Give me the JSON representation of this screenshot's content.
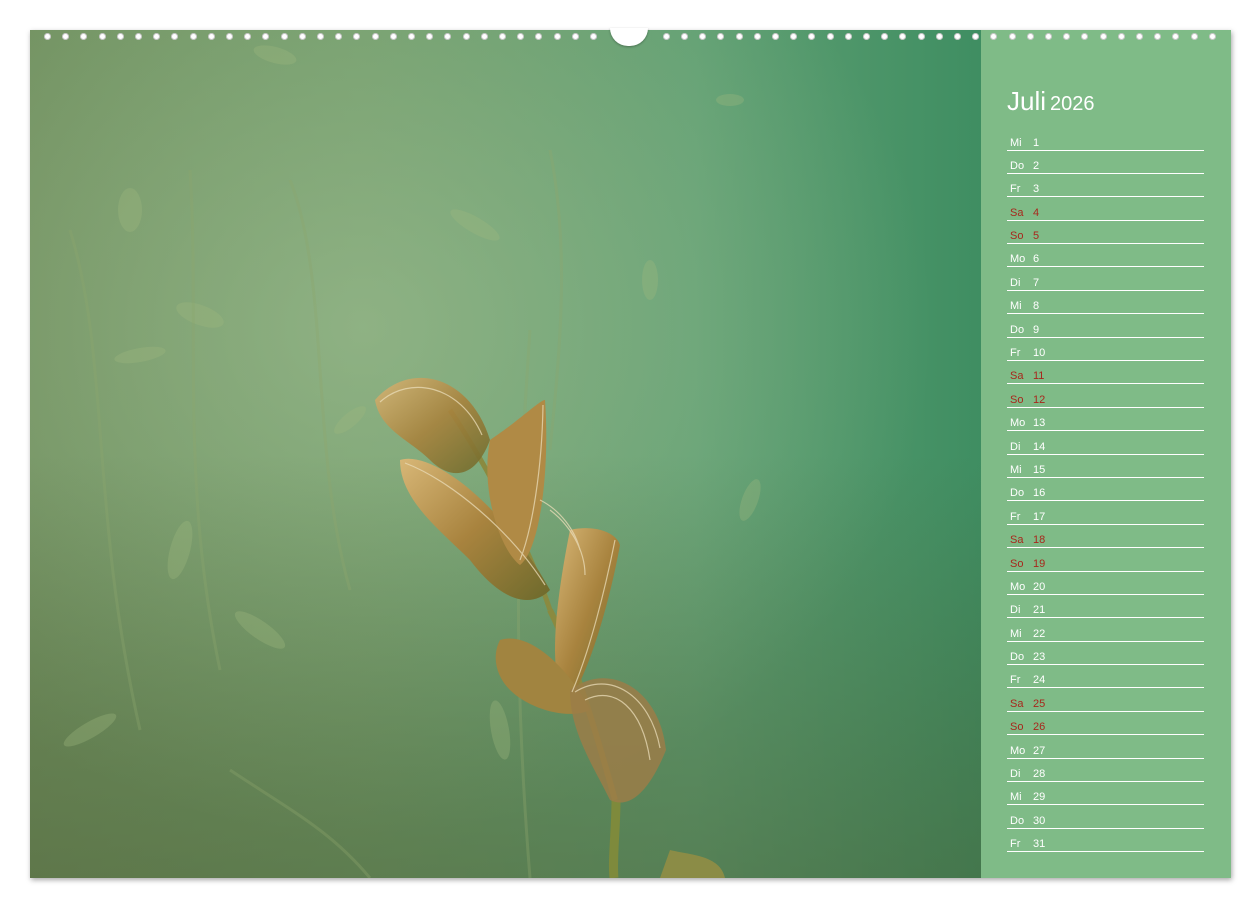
{
  "calendar": {
    "month": "Juli",
    "year": "2026",
    "days": [
      {
        "wd": "Mi",
        "d": "1",
        "we": false
      },
      {
        "wd": "Do",
        "d": "2",
        "we": false
      },
      {
        "wd": "Fr",
        "d": "3",
        "we": false
      },
      {
        "wd": "Sa",
        "d": "4",
        "we": true
      },
      {
        "wd": "So",
        "d": "5",
        "we": true
      },
      {
        "wd": "Mo",
        "d": "6",
        "we": false
      },
      {
        "wd": "Di",
        "d": "7",
        "we": false
      },
      {
        "wd": "Mi",
        "d": "8",
        "we": false
      },
      {
        "wd": "Do",
        "d": "9",
        "we": false
      },
      {
        "wd": "Fr",
        "d": "10",
        "we": false
      },
      {
        "wd": "Sa",
        "d": "11",
        "we": true
      },
      {
        "wd": "So",
        "d": "12",
        "we": true
      },
      {
        "wd": "Mo",
        "d": "13",
        "we": false
      },
      {
        "wd": "Di",
        "d": "14",
        "we": false
      },
      {
        "wd": "Mi",
        "d": "15",
        "we": false
      },
      {
        "wd": "Do",
        "d": "16",
        "we": false
      },
      {
        "wd": "Fr",
        "d": "17",
        "we": false
      },
      {
        "wd": "Sa",
        "d": "18",
        "we": true
      },
      {
        "wd": "So",
        "d": "19",
        "we": true
      },
      {
        "wd": "Mo",
        "d": "20",
        "we": false
      },
      {
        "wd": "Di",
        "d": "21",
        "we": false
      },
      {
        "wd": "Mi",
        "d": "22",
        "we": false
      },
      {
        "wd": "Do",
        "d": "23",
        "we": false
      },
      {
        "wd": "Fr",
        "d": "24",
        "we": false
      },
      {
        "wd": "Sa",
        "d": "25",
        "we": true
      },
      {
        "wd": "So",
        "d": "26",
        "we": true
      },
      {
        "wd": "Mo",
        "d": "27",
        "we": false
      },
      {
        "wd": "Di",
        "d": "28",
        "we": false
      },
      {
        "wd": "Mi",
        "d": "29",
        "we": false
      },
      {
        "wd": "Do",
        "d": "30",
        "we": false
      },
      {
        "wd": "Fr",
        "d": "31",
        "we": false
      }
    ]
  },
  "colors": {
    "sidebar": "#7fbb87",
    "weekend_text": "#a8271c",
    "text": "#ffffff"
  },
  "photo": {
    "subject": "underwater-pondweed-plant",
    "icon": "plant-photo"
  }
}
